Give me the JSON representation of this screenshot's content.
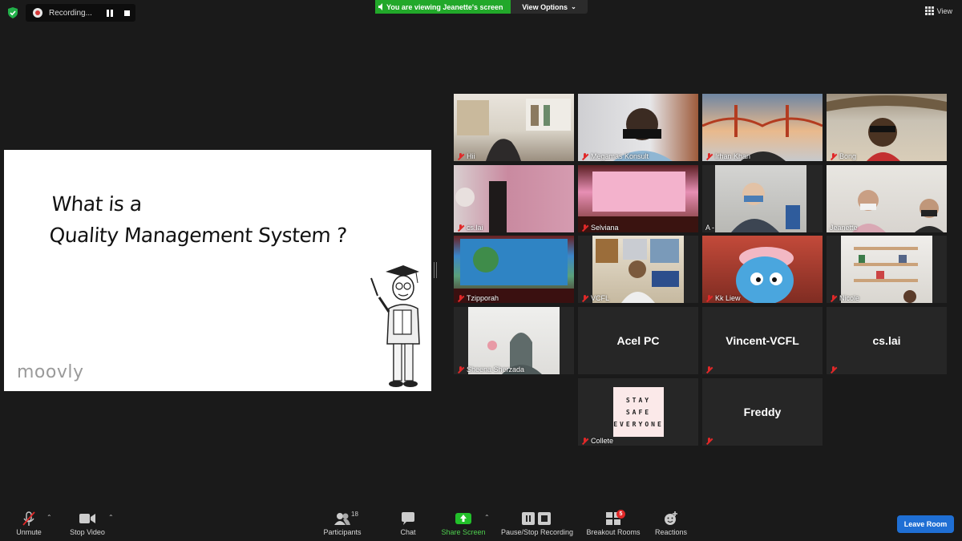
{
  "top": {
    "recording_label": "Recording...",
    "viewing_banner": "You are viewing Jeanette's screen",
    "view_options": "View Options",
    "view_button": "View"
  },
  "slide": {
    "title_line1": "What is a",
    "title_line2": "Quality Management System ?",
    "brand": "moovly"
  },
  "participants": [
    {
      "name": "Hii"
    },
    {
      "name": "Megamas Konsult"
    },
    {
      "name": "Irhan Khan"
    },
    {
      "name": "Bong"
    },
    {
      "name": "cs.lai"
    },
    {
      "name": "Selviana"
    },
    {
      "name": "A -"
    },
    {
      "name": "Jeanette"
    },
    {
      "name": "Tzipporah"
    },
    {
      "name": "VCFL"
    },
    {
      "name": "Kk Liew"
    },
    {
      "name": "Nicole"
    },
    {
      "name": "Sheena Sherzada"
    },
    {
      "name": "Acel PC"
    },
    {
      "name": "Vincent-VCFL"
    },
    {
      "name": "cs.lai"
    },
    {
      "name": "Collete"
    },
    {
      "name": "Freddy"
    }
  ],
  "collete_sign": [
    "STAY",
    "SAFE",
    "EVERYONE"
  ],
  "toolbar": {
    "unmute": "Unmute",
    "stop_video": "Stop Video",
    "participants": "Participants",
    "participants_count": "18",
    "chat": "Chat",
    "share_screen": "Share Screen",
    "pause_stop_recording": "Pause/Stop Recording",
    "breakout_rooms": "Breakout Rooms",
    "breakout_badge": "5",
    "reactions": "Reactions",
    "leave_room": "Leave Room"
  },
  "colors": {
    "background": "#1a1a1a",
    "viewing_banner": "#22a82a",
    "leave_button": "#1f6fd4",
    "active_speaker": "#d6e05a",
    "mute_icon": "#e02828",
    "share_screen_icon": "#22c02a"
  }
}
